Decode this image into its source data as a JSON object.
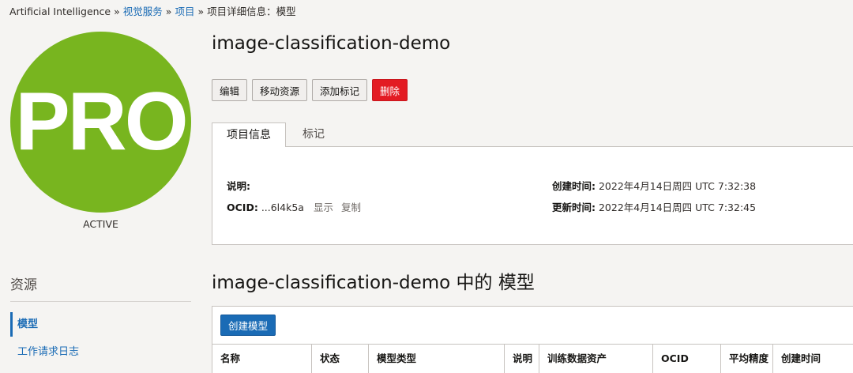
{
  "breadcrumb": {
    "root": "Artificial Intelligence",
    "sep": "»",
    "service": "视觉服务",
    "projects": "项目",
    "current": "项目详细信息：模型"
  },
  "project": {
    "name": "image-classification-demo",
    "avatar_text": "PRO",
    "avatar_color": "#78b51f",
    "status": "ACTIVE"
  },
  "actions": {
    "edit": "编辑",
    "move": "移动资源",
    "add_tags": "添加标记",
    "delete": "删除"
  },
  "tabs": {
    "info": "项目信息",
    "tags": "标记"
  },
  "details": {
    "description_label": "说明:",
    "description_value": "",
    "ocid_label": "OCID:",
    "ocid_value": "...6l4k5a",
    "show_link": "显示",
    "copy_link": "复制",
    "created_label": "创建时间:",
    "created_value": "2022年4月14日周四 UTC 7:32:38",
    "updated_label": "更新时间:",
    "updated_value": "2022年4月14日周四 UTC 7:32:45"
  },
  "resources": {
    "title": "资源",
    "items": [
      "模型",
      "工作请求日志"
    ]
  },
  "models": {
    "section_title": "image-classification-demo 中的 模型",
    "create_button": "创建模型",
    "columns": [
      "名称",
      "状态",
      "模型类型",
      "说明",
      "训练数据资产",
      "OCID",
      "平均精度",
      "创建时间"
    ]
  },
  "colors": {
    "link": "#1a6bb5",
    "danger": "#e31b23",
    "primary": "#1a6bb5"
  }
}
